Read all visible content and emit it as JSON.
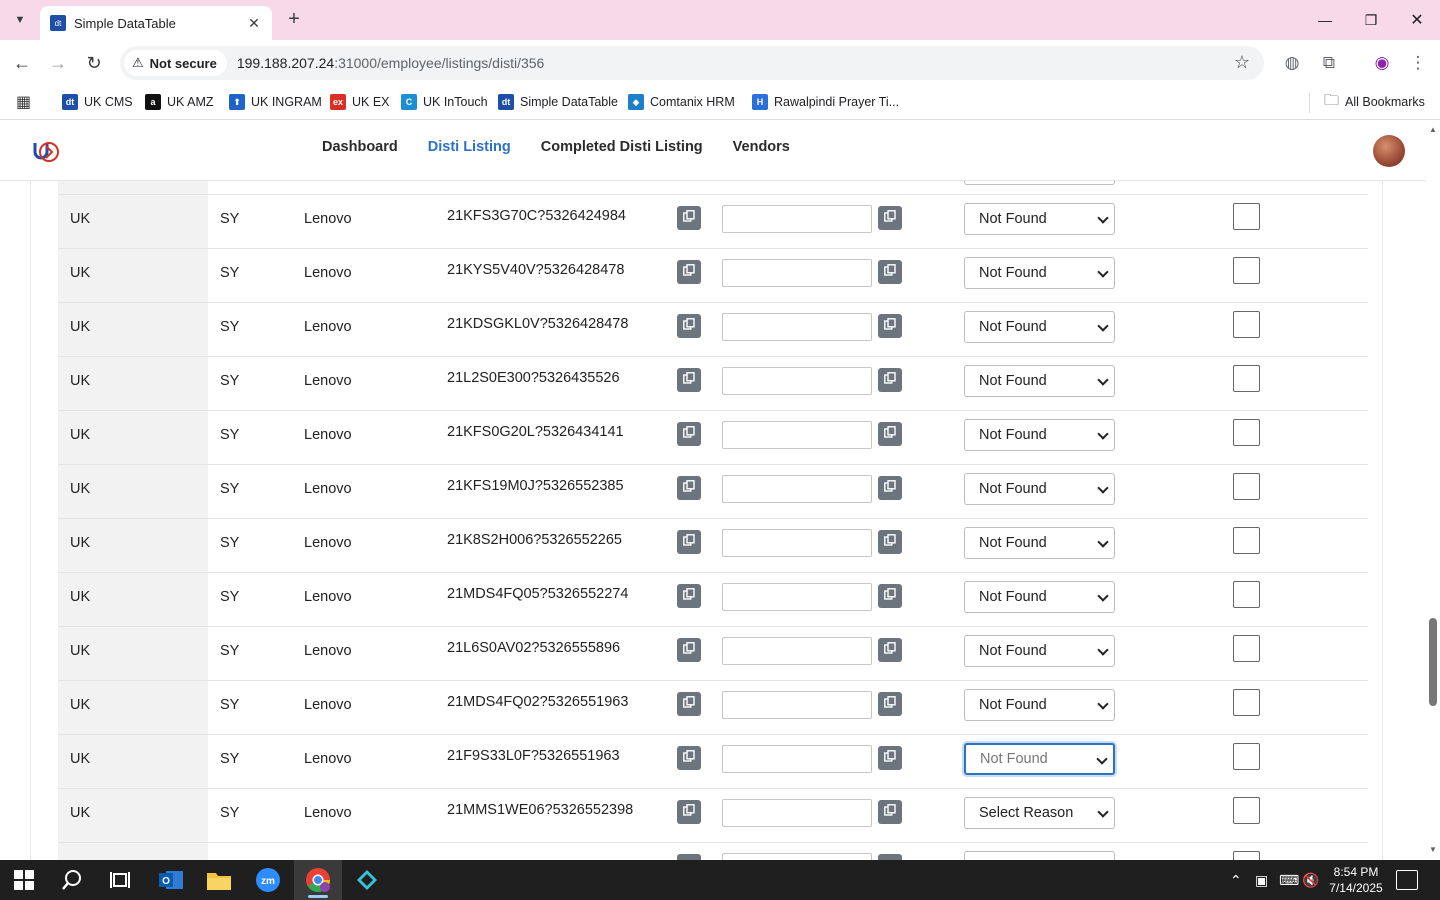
{
  "browser": {
    "tab_title": "Simple DataTable",
    "tab_favicon_text": "dt",
    "security_label": "Not secure",
    "url_host": "199.188.207.24",
    "url_path": ":31000/employee/listings/disti/356",
    "bookmarks": [
      {
        "label": "UK CMS",
        "icon_text": "dt",
        "color": "#1d4fa8"
      },
      {
        "label": "UK AMZ",
        "icon_text": "a",
        "color": "#111111"
      },
      {
        "label": "UK INGRAM",
        "icon_text": "⬆",
        "color": "#1e63c9"
      },
      {
        "label": "UK EX",
        "icon_text": "ex",
        "color": "#d93025"
      },
      {
        "label": "UK InTouch",
        "icon_text": "C",
        "color": "#1b8ed6"
      },
      {
        "label": "Simple DataTable",
        "icon_text": "dt",
        "color": "#1d4fa8"
      },
      {
        "label": "Comtanix HRM",
        "icon_text": "◆",
        "color": "#1b7fc9"
      },
      {
        "label": "Rawalpindi Prayer Ti...",
        "icon_text": "H",
        "color": "#2a6fdb"
      }
    ],
    "all_bookmarks_label": "All Bookmarks"
  },
  "app": {
    "nav": {
      "dashboard": "Dashboard",
      "disti_listing": "Disti Listing",
      "completed": "Completed Disti Listing",
      "vendors": "Vendors"
    },
    "accent_color": "#2d73c5"
  },
  "rows": [
    {
      "country": "UK",
      "code": "SY",
      "vendor": "Lenovo",
      "part": "21KFS3G70C?5326424984",
      "reason": "Not Found"
    },
    {
      "country": "UK",
      "code": "SY",
      "vendor": "Lenovo",
      "part": "21KYS5V40V?5326428478",
      "reason": "Not Found"
    },
    {
      "country": "UK",
      "code": "SY",
      "vendor": "Lenovo",
      "part": "21KDSGKL0V?5326428478",
      "reason": "Not Found"
    },
    {
      "country": "UK",
      "code": "SY",
      "vendor": "Lenovo",
      "part": "21L2S0E300?5326435526",
      "reason": "Not Found"
    },
    {
      "country": "UK",
      "code": "SY",
      "vendor": "Lenovo",
      "part": "21KFS0G20L?5326434141",
      "reason": "Not Found"
    },
    {
      "country": "UK",
      "code": "SY",
      "vendor": "Lenovo",
      "part": "21KFS19M0J?5326552385",
      "reason": "Not Found"
    },
    {
      "country": "UK",
      "code": "SY",
      "vendor": "Lenovo",
      "part": "21K8S2H006?5326552265",
      "reason": "Not Found"
    },
    {
      "country": "UK",
      "code": "SY",
      "vendor": "Lenovo",
      "part": "21MDS4FQ05?5326552274",
      "reason": "Not Found"
    },
    {
      "country": "UK",
      "code": "SY",
      "vendor": "Lenovo",
      "part": "21L6S0AV02?5326555896",
      "reason": "Not Found"
    },
    {
      "country": "UK",
      "code": "SY",
      "vendor": "Lenovo",
      "part": "21MDS4FQ02?5326551963",
      "reason": "Not Found"
    },
    {
      "country": "UK",
      "code": "SY",
      "vendor": "Lenovo",
      "part": "21F9S33L0F?5326551963",
      "reason": "Not Found",
      "focused": true
    },
    {
      "country": "UK",
      "code": "SY",
      "vendor": "Lenovo",
      "part": "21MMS1WE06?5326552398",
      "reason": "Select Reason"
    }
  ],
  "taskbar": {
    "time": "8:54 PM",
    "date": "7/14/2025",
    "apps": [
      "start-icon",
      "search-icon",
      "task-view-icon",
      "outlook-icon",
      "file-explorer-icon",
      "zoom-icon",
      "chrome-icon",
      "vscode-icon"
    ]
  }
}
